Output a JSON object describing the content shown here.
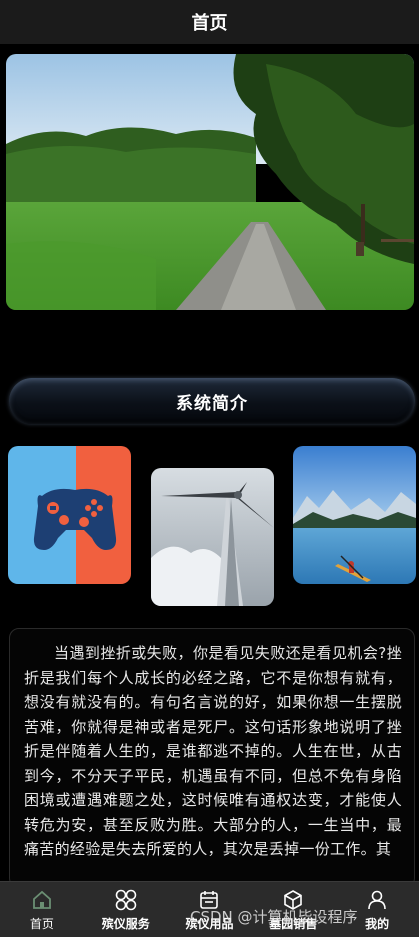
{
  "header": {
    "title": "首页"
  },
  "section": {
    "title": "系统简介"
  },
  "intro": {
    "text": "当遇到挫折或失败，你是看见失败还是看见机会?挫折是我们每个人成长的必经之路，它不是你想有就有，想没有就没有的。有句名言说的好，如果你想一生摆脱苦难，你就得是神或者是死尸。这句话形象地说明了挫折是伴随着人生的，是谁都逃不掉的。人生在世，从古到今，不分天子平民，机遇虽有不同，但总不免有身陷困境或遭遇难题之处，这时候唯有通权达变，才能使人转危为安，甚至反败为胜。大部分的人，一生当中，最痛苦的经验是失去所爱的人，其次是丢掉一份工作。其"
  },
  "tabs": [
    {
      "label": "首页",
      "icon": "home-icon"
    },
    {
      "label": "殡仪服务",
      "icon": "grid-icon"
    },
    {
      "label": "殡仪用品",
      "icon": "calendar-icon"
    },
    {
      "label": "墓园销售",
      "icon": "cube-icon"
    },
    {
      "label": "我的",
      "icon": "user-icon"
    }
  ],
  "watermark": "CSDN @计算机毕设程序",
  "colors": {
    "background": "#000000",
    "tab_bar": "#2b2b2b",
    "nav_bar": "#1b1b1b"
  }
}
